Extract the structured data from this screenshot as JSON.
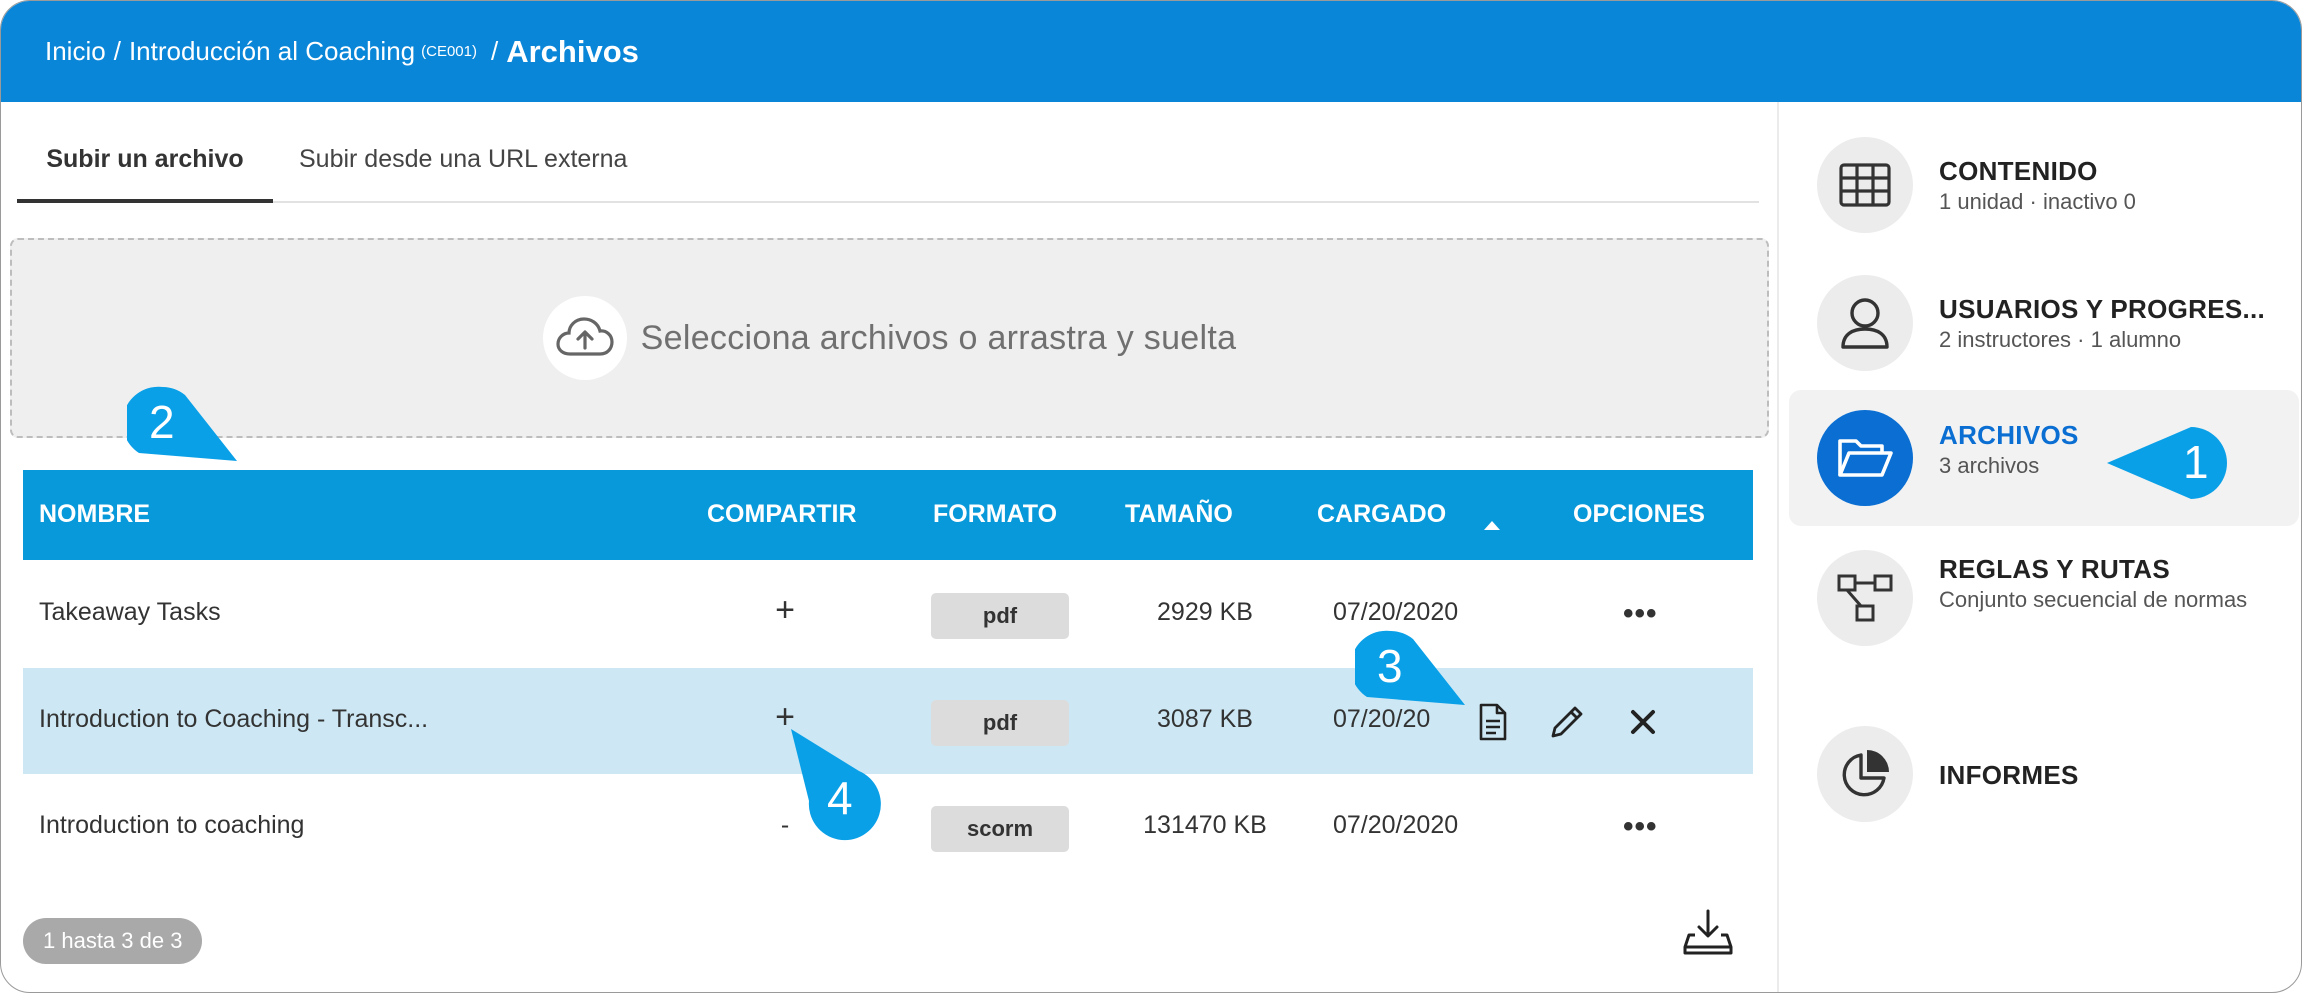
{
  "breadcrumb": {
    "home": "Inicio",
    "separator": "/",
    "course": "Introducción al Coaching",
    "course_code": "(CE001)",
    "current": "Archivos"
  },
  "tabs": [
    {
      "label": "Subir un archivo",
      "active": true
    },
    {
      "label": "Subir desde una URL externa",
      "active": false
    }
  ],
  "dropzone": {
    "label": "Selecciona archivos o arrastra y suelta",
    "icon": "cloud-upload-icon"
  },
  "table": {
    "columns": [
      "NOMBRE",
      "COMPARTIR",
      "FORMATO",
      "TAMAÑO",
      "CARGADO",
      "OPCIONES"
    ],
    "sort_column": "CARGADO",
    "sort_direction": "ascending",
    "rows": [
      {
        "name": "Takeaway Tasks",
        "share": "+",
        "format": "pdf",
        "size": "2929 KB",
        "uploaded": "07/20/2020",
        "options": "•••"
      },
      {
        "name": "Introduction to Coaching - Transc...",
        "share": "+",
        "format": "pdf",
        "size": "3087 KB",
        "uploaded": "07/20/20",
        "options": ""
      },
      {
        "name": "Introduction to coaching",
        "share": "-",
        "format": "scorm",
        "size": "131470 KB",
        "uploaded": "07/20/2020",
        "options": "•••"
      }
    ],
    "row_actions": [
      "document-icon",
      "pencil-icon",
      "close-icon"
    ]
  },
  "pagination": {
    "label": "1 hasta 3 de 3"
  },
  "sidebar": {
    "items": [
      {
        "title": "CONTENIDO",
        "subtitle": "1 unidad · inactivo 0",
        "icon": "grid-icon",
        "active": false
      },
      {
        "title": "USUARIOS Y PROGRES...",
        "subtitle": "2 instructores · 1 alumno",
        "icon": "user-icon",
        "active": false
      },
      {
        "title": "ARCHIVOS",
        "subtitle": "3 archivos",
        "icon": "folder-open-icon",
        "active": true
      },
      {
        "title": "REGLAS Y RUTAS",
        "subtitle": "Conjunto secuencial de normas",
        "icon": "flow-icon",
        "active": false
      },
      {
        "title": "INFORMES",
        "subtitle": "",
        "icon": "pie-chart-icon",
        "active": false
      }
    ]
  },
  "callouts": [
    "1",
    "2",
    "3",
    "4"
  ],
  "colors": {
    "header": "#0a86d8",
    "table_header": "#0799da",
    "highlight_row": "#cde8f4",
    "callout": "#0aa0e8",
    "active_icon": "#0a6ed2"
  }
}
